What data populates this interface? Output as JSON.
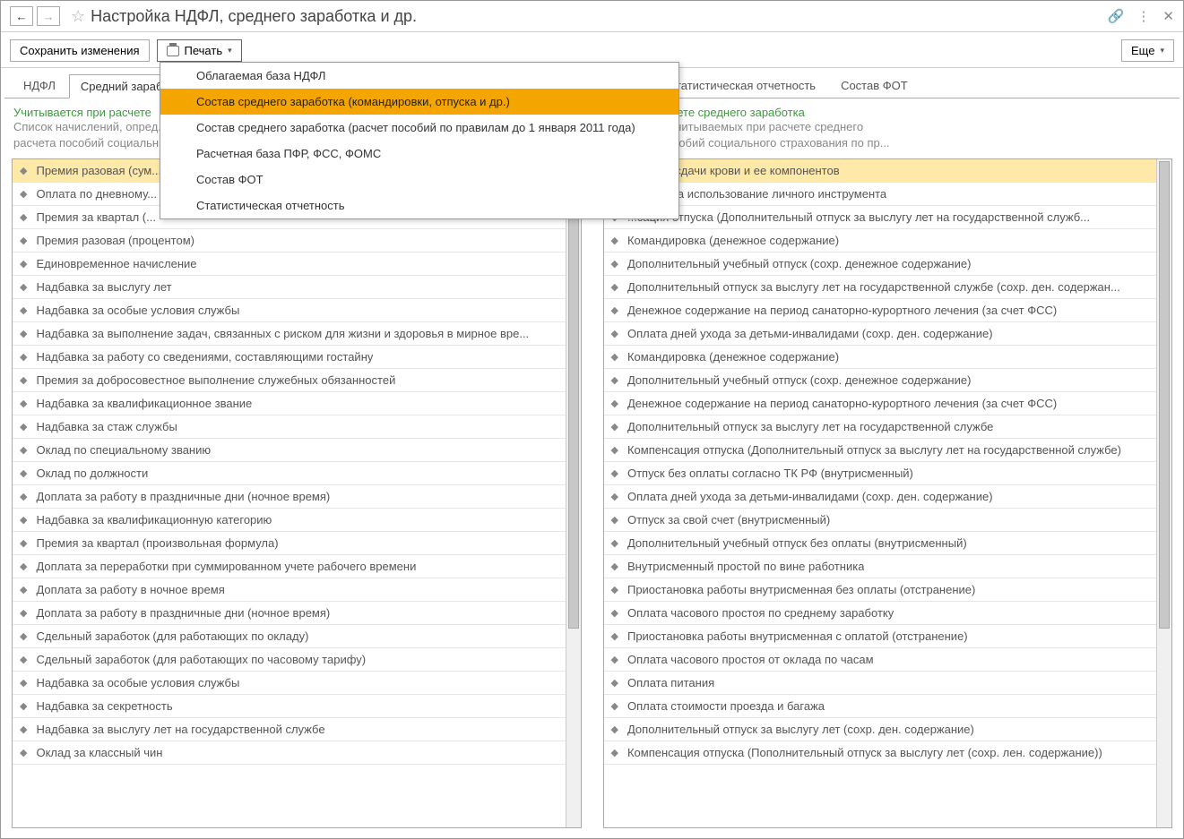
{
  "header": {
    "title": "Настройка НДФЛ, среднего заработка и др."
  },
  "toolbar": {
    "save_label": "Сохранить изменения",
    "print_label": "Печать",
    "more_label": "Еще"
  },
  "dropdown": {
    "items": [
      "Облагаемая база НДФЛ",
      "Состав среднего заработка (командировки, отпуска и др.)",
      "Состав среднего заработка (расчет пособий по правилам до 1 января 2011 года)",
      "Расчетная база ПФР, ФСС, ФОМС",
      "Состав ФОТ",
      "Статистическая отчетность"
    ],
    "hovered_index": 1
  },
  "left_panel": {
    "tabs": [
      "НДФЛ",
      "Средний зараб..."
    ],
    "active_tab": 1,
    "title_green": "Учитывается при расчете",
    "subtitle_gray": "Список начислений, опред...\nрасчета пособий социальн...",
    "items": [
      "Премия разовая (сум...",
      "Оплата по дневному...",
      "Премия за квартал (...",
      "Премия разовая (процентом)",
      "Единовременное начисление",
      "Надбавка за выслугу лет",
      "Надбавка за особые условия службы",
      "Надбавка за выполнение задач, связанных с риском для жизни и здоровья в мирное вре...",
      "Надбавка за работу со сведениями, составляющими гостайну",
      "Премия за добросовестное выполнение служебных обязанностей",
      "Надбавка за квалификационное звание",
      "Надбавка за стаж службы",
      "Оклад по специальному званию",
      "Оклад по должности",
      "Доплата за работу в праздничные дни (ночное время)",
      "Надбавка за квалификационную категорию",
      "Премия за квартал (произвольная формула)",
      "Доплата за переработки при суммированном учете рабочего времени",
      "Доплата за работу в ночное время",
      "Доплата за работу в праздничные дни (ночное время)",
      "Сдельный заработок (для работающих по окладу)",
      "Сдельный заработок (для работающих по часовому тарифу)",
      "Надбавка за особые условия службы",
      "Надбавка за секретность",
      "Надбавка за выслугу лет на государственной службе",
      "Оклад за классный чин"
    ],
    "selected_index": 0
  },
  "right_panel": {
    "tabs": [
      "...МС",
      "Статистическая отчетность",
      "Состав ФОТ"
    ],
    "active_tab": 0,
    "title_green": "...ся при расчете среднего заработка",
    "subtitle_gray": "...лений, не учитываемых при расчете среднего\n...расчета пособий социального страхования по пр...",
    "items": [
      "...за дни сдачи крови и ее компонентов",
      "...сация за использование личного инструмента",
      "...сация отпуска (Дополнительный отпуск за выслугу лет на государственной служб...",
      "Командировка (денежное содержание)",
      "Дополнительный учебный отпуск (сохр. денежное содержание)",
      "Дополнительный отпуск за выслугу лет на государственной службе (сохр. ден. содержан...",
      "Денежное содержание на период санаторно-курортного лечения (за счет ФСС)",
      "Оплата дней ухода за детьми-инвалидами (сохр. ден. содержание)",
      "Командировка (денежное содержание)",
      "Дополнительный учебный отпуск (сохр. денежное содержание)",
      "Денежное содержание на период санаторно-курортного лечения (за счет ФСС)",
      "Дополнительный отпуск за выслугу лет на государственной службе",
      "Компенсация отпуска (Дополнительный отпуск за выслугу лет на государственной службе)",
      "Отпуск без оплаты согласно ТК РФ (внутрисменный)",
      "Оплата дней ухода за детьми-инвалидами (сохр. ден. содержание)",
      "Отпуск за свой счет (внутрисменный)",
      "Дополнительный учебный отпуск без оплаты (внутрисменный)",
      "Внутрисменный простой по вине работника",
      "Приостановка работы внутрисменная без оплаты (отстранение)",
      "Оплата часового простоя по среднему заработку",
      "Приостановка работы внутрисменная с оплатой (отстранение)",
      "Оплата часового простоя от оклада по часам",
      "Оплата питания",
      "Оплата стоимости проезда и багажа",
      "Дополнительный отпуск за выслугу лет (сохр. ден. содержание)",
      "Компенсация отпуска (Пополнительный отпуск за выслугу лет (сохр. лен. содержание))"
    ],
    "selected_index": 0
  }
}
